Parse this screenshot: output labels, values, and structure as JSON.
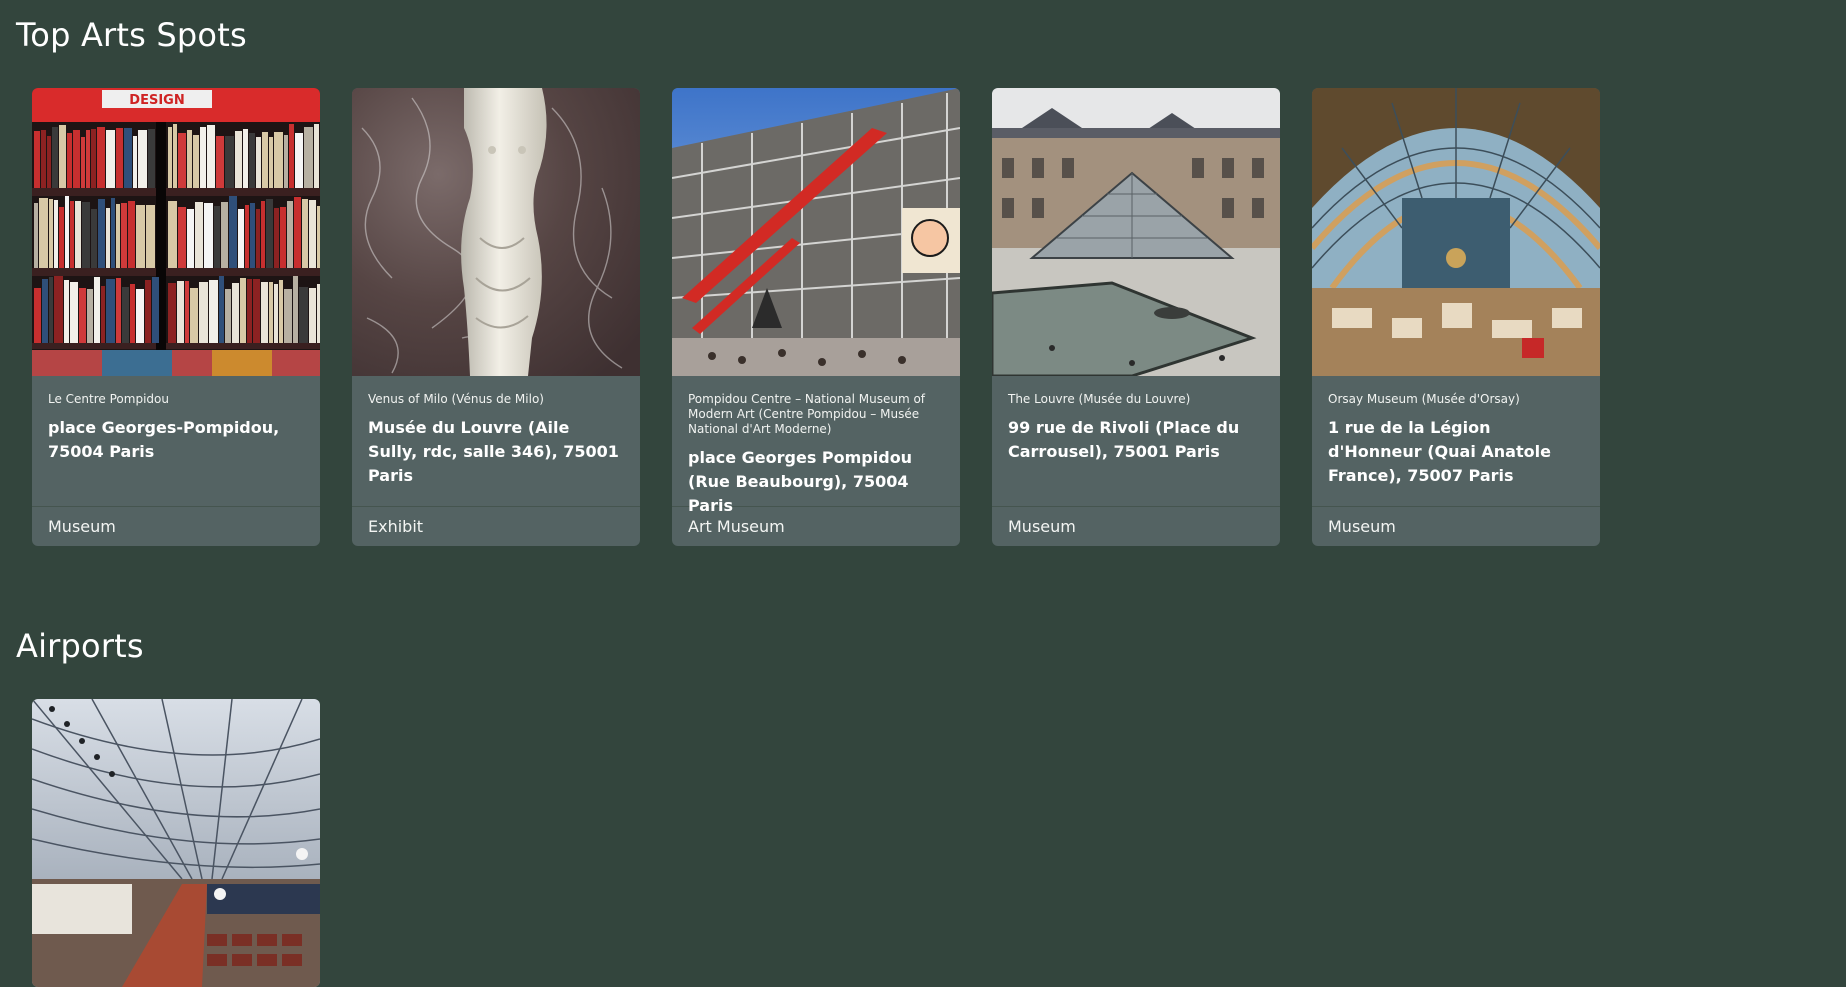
{
  "sections": [
    {
      "title": "Top Arts Spots",
      "cards": [
        {
          "name": "Le Centre Pompidou",
          "address": "place Georges-Pompidou, 75004 Paris",
          "category": "Museum",
          "image": "bookshelf-photo"
        },
        {
          "name": "Venus of Milo (Vénus de Milo)",
          "address": "Musée du Louvre (Aile Sully, rdc, salle 346), 75001 Paris",
          "category": "Exhibit",
          "image": "marble-statue-photo"
        },
        {
          "name": "Pompidou Centre – National Museum of Modern Art (Centre Pompidou – Musée National d'Art Moderne)",
          "address": "place Georges Pompidou (Rue Beaubourg), 75004 Paris",
          "category": "Art Museum",
          "image": "pompidou-facade-photo"
        },
        {
          "name": "The Louvre (Musée du Louvre)",
          "address": "99 rue de Rivoli (Place du Carrousel), 75001 Paris",
          "category": "Museum",
          "image": "louvre-pyramid-photo"
        },
        {
          "name": "Orsay Museum (Musée d'Orsay)",
          "address": "1 rue de la Légion d'Honneur (Quai Anatole France), 75007 Paris",
          "category": "Museum",
          "image": "orsay-hall-photo"
        }
      ]
    },
    {
      "title": "Airports",
      "cards": [
        {
          "image": "airport-terminal-photo"
        }
      ]
    }
  ],
  "image_text": {
    "bookshelf_sign": "DESIGN"
  }
}
